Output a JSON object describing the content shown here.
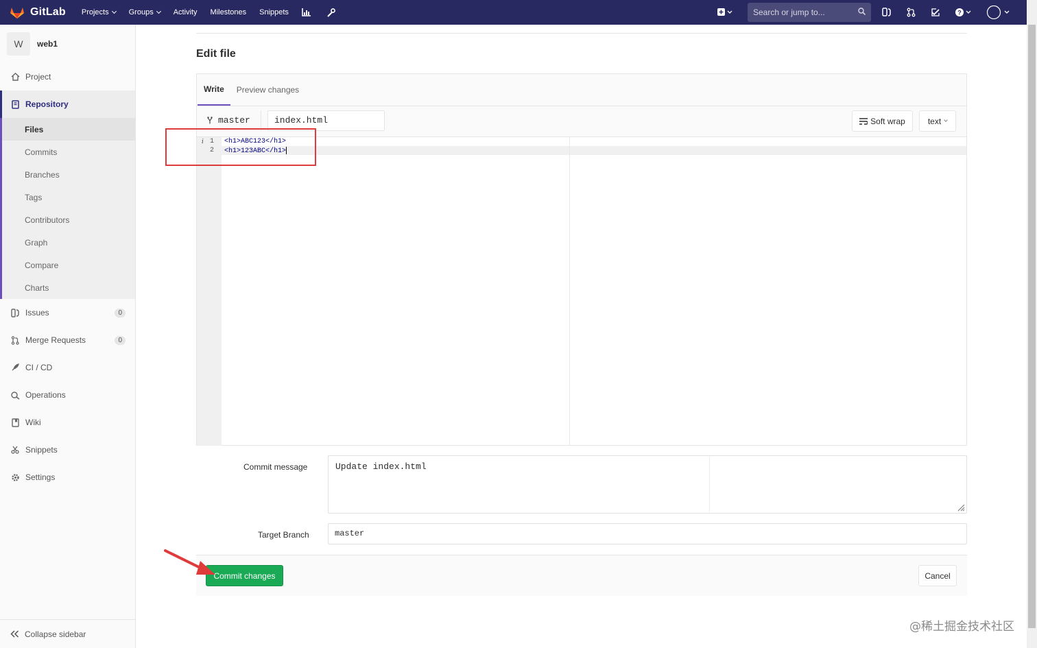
{
  "app": {
    "name": "GitLab"
  },
  "navbar": {
    "links": [
      {
        "label": "Projects",
        "caret": true
      },
      {
        "label": "Groups",
        "caret": true
      },
      {
        "label": "Activity",
        "caret": false
      },
      {
        "label": "Milestones",
        "caret": false
      },
      {
        "label": "Snippets",
        "caret": false
      }
    ],
    "search_placeholder": "Search or jump to..."
  },
  "sidebar": {
    "project_initial": "W",
    "project_name": "web1",
    "items": [
      {
        "label": "Project",
        "icon": "home-icon"
      },
      {
        "label": "Repository",
        "icon": "book-icon"
      }
    ],
    "repo_sub": [
      "Files",
      "Commits",
      "Branches",
      "Tags",
      "Contributors",
      "Graph",
      "Compare",
      "Charts"
    ],
    "lower_items": [
      {
        "label": "Issues",
        "badge": "0",
        "icon": "issues-icon"
      },
      {
        "label": "Merge Requests",
        "badge": "0",
        "icon": "merge-request-icon"
      },
      {
        "label": "CI / CD",
        "icon": "rocket-icon"
      },
      {
        "label": "Operations",
        "icon": "operations-icon"
      },
      {
        "label": "Wiki",
        "icon": "wiki-icon"
      },
      {
        "label": "Snippets",
        "icon": "snippet-icon"
      },
      {
        "label": "Settings",
        "icon": "gear-icon"
      }
    ],
    "collapse": "Collapse sidebar"
  },
  "page": {
    "title": "Edit file"
  },
  "editor": {
    "tab_write": "Write",
    "tab_preview": "Preview changes",
    "branch": "master",
    "filename": "index.html",
    "soft_wrap": "Soft wrap",
    "mode": "text",
    "lines": [
      {
        "num": "1",
        "text": "<h1>ABC123</h1>"
      },
      {
        "num": "2",
        "text": "<h1>123ABC</h1>"
      }
    ]
  },
  "form": {
    "commit_label": "Commit message",
    "commit_value": "Update index.html",
    "target_label": "Target Branch",
    "target_value": "master",
    "commit_button": "Commit changes",
    "cancel_button": "Cancel"
  },
  "watermark": "@稀土掘金技术社区",
  "colors": {
    "navbar": "#292961",
    "commit": "#1aaa55",
    "annotation": "#e03b3b"
  }
}
